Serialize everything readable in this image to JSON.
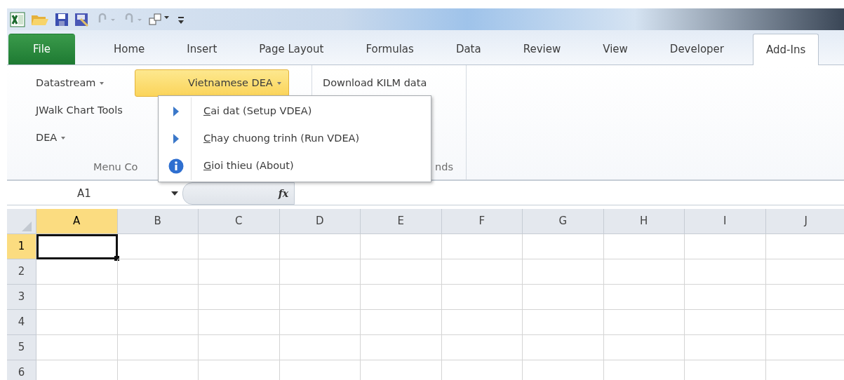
{
  "ribbon_tabs": [
    {
      "label": "File",
      "kind": "file",
      "selected": false
    },
    {
      "label": "Home",
      "kind": "tab",
      "selected": false
    },
    {
      "label": "Insert",
      "kind": "tab",
      "selected": false
    },
    {
      "label": "Page Layout",
      "kind": "tab",
      "selected": false
    },
    {
      "label": "Formulas",
      "kind": "tab",
      "selected": false
    },
    {
      "label": "Data",
      "kind": "tab",
      "selected": false
    },
    {
      "label": "Review",
      "kind": "tab",
      "selected": false
    },
    {
      "label": "View",
      "kind": "tab",
      "selected": false
    },
    {
      "label": "Developer",
      "kind": "tab",
      "selected": false
    },
    {
      "label": "Add-Ins",
      "kind": "tab",
      "selected": true
    }
  ],
  "ribbon": {
    "groups": [
      {
        "label": "Menu Co",
        "columns": [
          [
            {
              "label": "Datastream",
              "dropdown": true,
              "highlighted": false
            },
            {
              "label": "JWalk Chart Tools",
              "dropdown": false,
              "highlighted": false
            },
            {
              "label": "DEA",
              "dropdown": true,
              "highlighted": false
            }
          ],
          [
            {
              "label": "Vietnamese DEA",
              "dropdown": true,
              "highlighted": true
            }
          ]
        ]
      },
      {
        "label": "nds",
        "columns": [
          [
            {
              "label": "Download KILM data",
              "dropdown": false,
              "highlighted": false
            }
          ]
        ]
      }
    ]
  },
  "dropdown_menu": {
    "items": [
      {
        "label": "Cai dat (Setup VDEA)",
        "kind": "arrow"
      },
      {
        "label": "Chay chuong trinh (Run VDEA)",
        "kind": "arrow"
      },
      {
        "label": "Gioi thieu (About)",
        "kind": "info"
      }
    ]
  },
  "name_box": {
    "value": "A1"
  },
  "formula_bar": {
    "function_button": "fx"
  },
  "sheet": {
    "columns": [
      {
        "label": "A",
        "selected": true
      },
      {
        "label": "B",
        "selected": false
      },
      {
        "label": "C",
        "selected": false
      },
      {
        "label": "D",
        "selected": false
      },
      {
        "label": "E",
        "selected": false
      },
      {
        "label": "F",
        "selected": false
      },
      {
        "label": "G",
        "selected": false
      },
      {
        "label": "H",
        "selected": false
      },
      {
        "label": "I",
        "selected": false
      },
      {
        "label": "J",
        "selected": false
      }
    ],
    "rows": [
      {
        "label": "1",
        "selected": true
      },
      {
        "label": "2",
        "selected": false
      },
      {
        "label": "3",
        "selected": false
      },
      {
        "label": "4",
        "selected": false
      },
      {
        "label": "5",
        "selected": false
      },
      {
        "label": "6",
        "selected": false
      }
    ]
  }
}
